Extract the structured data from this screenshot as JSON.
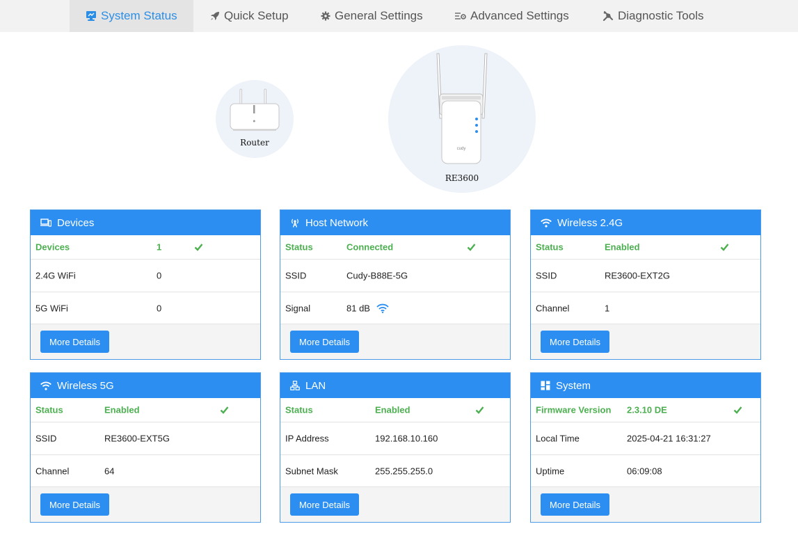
{
  "nav": {
    "tabs": [
      {
        "label": "System Status",
        "icon": "monitor-icon",
        "active": true
      },
      {
        "label": "Quick Setup",
        "icon": "rocket-icon",
        "active": false
      },
      {
        "label": "General Settings",
        "icon": "gear-icon",
        "active": false
      },
      {
        "label": "Advanced Settings",
        "icon": "sliders-icon",
        "active": false
      },
      {
        "label": "Diagnostic Tools",
        "icon": "tools-icon",
        "active": false
      }
    ]
  },
  "topology": {
    "router_label": "Router",
    "extender_label": "RE3600",
    "extender_brand": "cudy"
  },
  "colors": {
    "accent": "#2b8ef0",
    "ok_green": "#4caf50"
  },
  "cards": {
    "devices": {
      "title": "Devices",
      "icon": "devices-icon",
      "rows": [
        {
          "key": "Devices",
          "value": "1",
          "status": "ok"
        },
        {
          "key": "2.4G WiFi",
          "value": "0"
        },
        {
          "key": "5G WiFi",
          "value": "0"
        }
      ],
      "button": "More Details"
    },
    "host": {
      "title": "Host Network",
      "icon": "antenna-icon",
      "rows": [
        {
          "key": "Status",
          "value": "Connected",
          "status": "ok"
        },
        {
          "key": "SSID",
          "value": "Cudy-B88E-5G"
        },
        {
          "key": "Signal",
          "value": "81 dB",
          "icon": "wifi-signal-icon"
        }
      ],
      "button": "More Details"
    },
    "w24": {
      "title": "Wireless 2.4G",
      "icon": "wifi-icon",
      "rows": [
        {
          "key": "Status",
          "value": "Enabled",
          "status": "ok"
        },
        {
          "key": "SSID",
          "value": "RE3600-EXT2G"
        },
        {
          "key": "Channel",
          "value": "1"
        }
      ],
      "button": "More Details"
    },
    "w5": {
      "title": "Wireless 5G",
      "icon": "wifi-icon",
      "rows": [
        {
          "key": "Status",
          "value": "Enabled",
          "status": "ok"
        },
        {
          "key": "SSID",
          "value": "RE3600-EXT5G"
        },
        {
          "key": "Channel",
          "value": "64"
        }
      ],
      "button": "More Details"
    },
    "lan": {
      "title": "LAN",
      "icon": "network-icon",
      "rows": [
        {
          "key": "Status",
          "value": "Enabled",
          "status": "ok"
        },
        {
          "key": "IP Address",
          "value": "192.168.10.160"
        },
        {
          "key": "Subnet Mask",
          "value": "255.255.255.0"
        }
      ],
      "button": "More Details"
    },
    "system": {
      "title": "System",
      "icon": "dashboard-icon",
      "rows": [
        {
          "key": "Firmware Version",
          "value": "2.3.10 DE",
          "status": "ok"
        },
        {
          "key": "Local Time",
          "value": "2025-04-21 16:31:27"
        },
        {
          "key": "Uptime",
          "value": "06:09:08"
        }
      ],
      "button": "More Details"
    }
  }
}
